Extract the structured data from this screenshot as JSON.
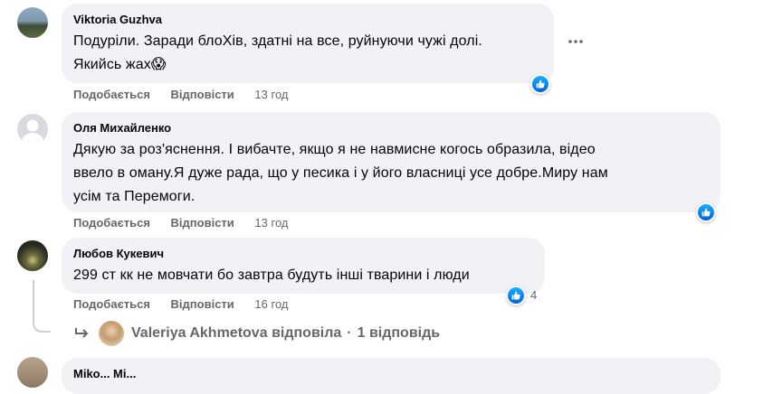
{
  "comments": [
    {
      "author": "Viktoria Guzhva",
      "line1": "Подурiли. Заради блоХiв, здатнi на все, руйнуючи чужi долi.",
      "line2": "Якийсь жах😱",
      "like": "Подобається",
      "reply": "Відповісти",
      "time": "13 год"
    },
    {
      "author": "Оля Михайленко",
      "line1": "Дякую за роз'яснення. І вибачте, якщо я не навмисне когось образила, відео",
      "line2": "ввело в оману.Я дуже рада, що у песика і у його власниці усе добре.Миру нам",
      "line3": "усім та Перемоги.",
      "like": "Подобається",
      "reply": "Відповісти",
      "time": "13 год"
    },
    {
      "author": "Любов Кукевич",
      "line1": "299 ст кк не мовчати бо завтра будуть інші тварини і люди",
      "like": "Подобається",
      "reply": "Відповісти",
      "time": "16 год",
      "reactions": "4"
    },
    {
      "author": "Miko... Mi..."
    }
  ],
  "replies_row": {
    "name": "Valeriya Akhmetova",
    "action": "відповіла",
    "sep": "·",
    "count": "1 відповідь"
  },
  "colors": {
    "bubble": "#f0f2f5",
    "secondary_text": "#65676b",
    "like_blue": "#0866ff"
  }
}
